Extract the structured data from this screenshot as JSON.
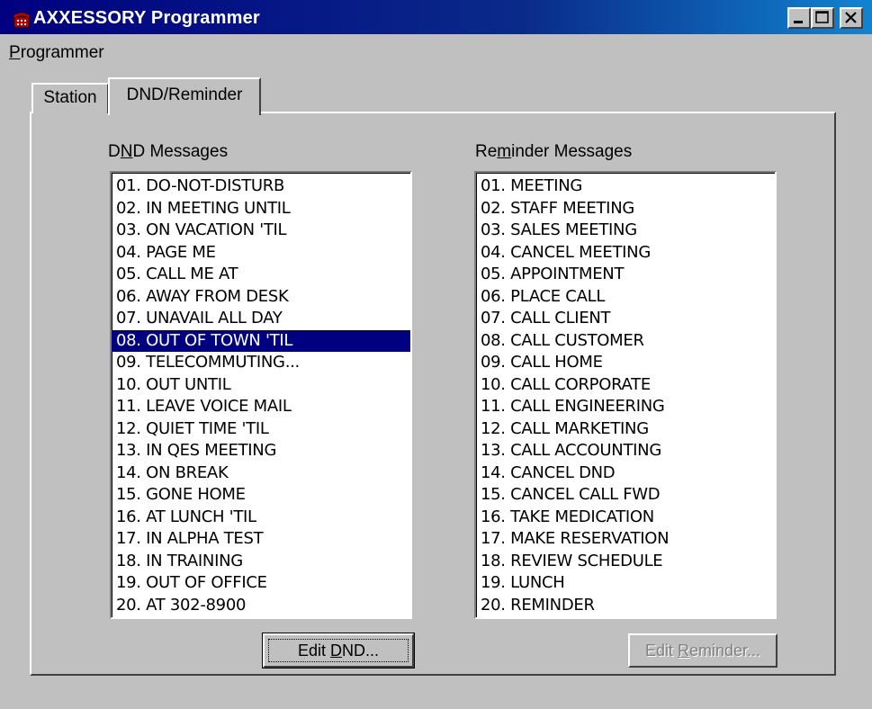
{
  "window": {
    "title": "AXXESSORY Programmer",
    "icon": "telephone-icon"
  },
  "menu": {
    "programmer": "Programmer"
  },
  "tabs": [
    {
      "label": "Station",
      "active": false
    },
    {
      "label": "DND/Reminder",
      "active": true
    }
  ],
  "dnd": {
    "label": "DND Messages",
    "selected_index": 7,
    "items": [
      "01. DO-NOT-DISTURB",
      "02. IN MEETING UNTIL",
      "03. ON VACATION 'TIL",
      "04. PAGE ME",
      "05. CALL ME AT",
      "06. AWAY FROM DESK",
      "07. UNAVAIL ALL DAY",
      "08. OUT OF TOWN 'TIL",
      "09. TELECOMMUTING...",
      "10. OUT UNTIL",
      "11. LEAVE VOICE MAIL",
      "12. QUIET TIME 'TIL",
      "13. IN QES MEETING",
      "14. ON BREAK",
      "15. GONE HOME",
      "16. AT LUNCH 'TIL",
      "17. IN ALPHA TEST",
      "18. IN TRAINING",
      "19. OUT OF OFFICE",
      "20. AT 302-8900"
    ],
    "button": "Edit DND..."
  },
  "reminder": {
    "label": "Reminder Messages",
    "items": [
      "01. MEETING",
      "02. STAFF MEETING",
      "03. SALES MEETING",
      "04. CANCEL MEETING",
      "05. APPOINTMENT",
      "06. PLACE CALL",
      "07. CALL CLIENT",
      "08. CALL CUSTOMER",
      "09. CALL HOME",
      "10. CALL CORPORATE",
      "11. CALL ENGINEERING",
      "12. CALL MARKETING",
      "13. CALL ACCOUNTING",
      "14. CANCEL DND",
      "15. CANCEL CALL FWD",
      "16. TAKE MEDICATION",
      "17. MAKE RESERVATION",
      "18. REVIEW SCHEDULE",
      "19. LUNCH",
      "20. REMINDER"
    ],
    "button": "Edit Reminder...",
    "button_enabled": false
  },
  "colors": {
    "face": "#c0c0c0",
    "title_start": "#000080",
    "title_end": "#1084d0",
    "selection": "#000080",
    "disabled_text": "#808080"
  }
}
